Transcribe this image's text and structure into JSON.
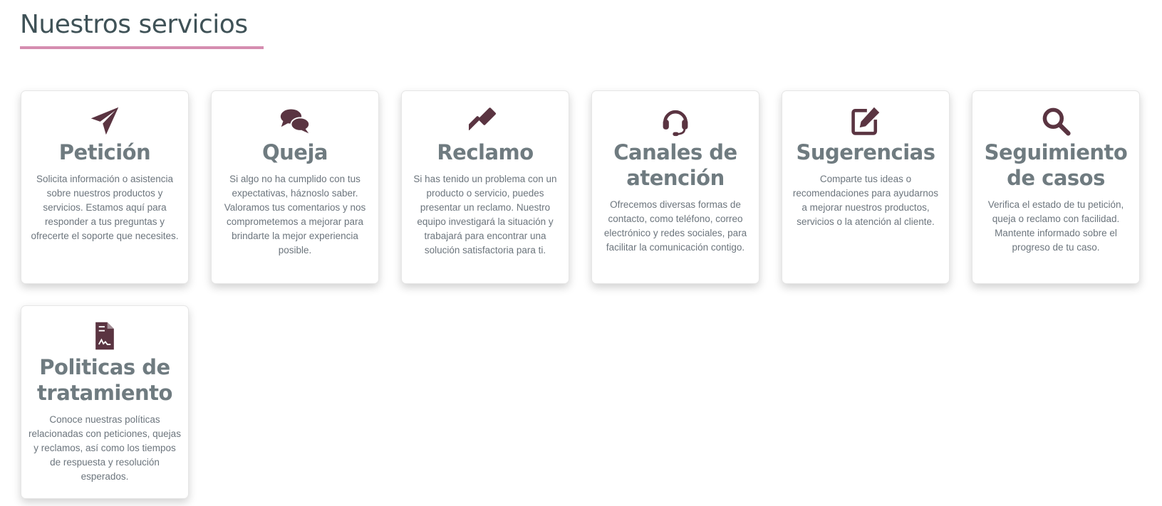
{
  "section": {
    "title": "Nuestros servicios",
    "accent_color": "#d58db0",
    "title_color": "#3f5257"
  },
  "icon_color": "#5a3441",
  "cards": [
    {
      "icon": "paper-plane-icon",
      "title": "Petición",
      "description": "Solicita información o asistencia sobre nuestros productos y servicios. Estamos aquí para responder a tus preguntas y ofrecerte el soporte que necesites."
    },
    {
      "icon": "comments-icon",
      "title": "Queja",
      "description": "Si algo no ha cumplido con tus expectativas, háznoslo saber. Valoramos tus comentarios y nos comprometemos a mejorar para brindarte la mejor experiencia posible."
    },
    {
      "icon": "gavel-icon",
      "title": "Reclamo",
      "description": "Si has tenido un problema con un producto o servicio, puedes presentar un reclamo. Nuestro equipo investigará la situación y trabajará para encontrar una solución satisfactoria para ti."
    },
    {
      "icon": "headset-icon",
      "title": "Canales de atención",
      "description": "Ofrecemos diversas formas de contacto, como teléfono, correo electrónico y redes sociales, para facilitar la comunicación contigo."
    },
    {
      "icon": "edit-icon",
      "title": "Sugerencias",
      "description": "Comparte tus ideas o recomendaciones para ayudarnos a mejorar nuestros productos, servicios o la atención al cliente."
    },
    {
      "icon": "search-icon",
      "title": "Seguimiento de casos",
      "description": "Verifica el estado de tu petición, queja o reclamo con facilidad. Mantente informado sobre el progreso de tu caso."
    },
    {
      "icon": "file-contract-icon",
      "title": "Politicas de tratamiento",
      "description": "Conoce nuestras políticas relacionadas con peticiones, quejas y reclamos, así como los tiempos de respuesta y resolución esperados."
    }
  ]
}
